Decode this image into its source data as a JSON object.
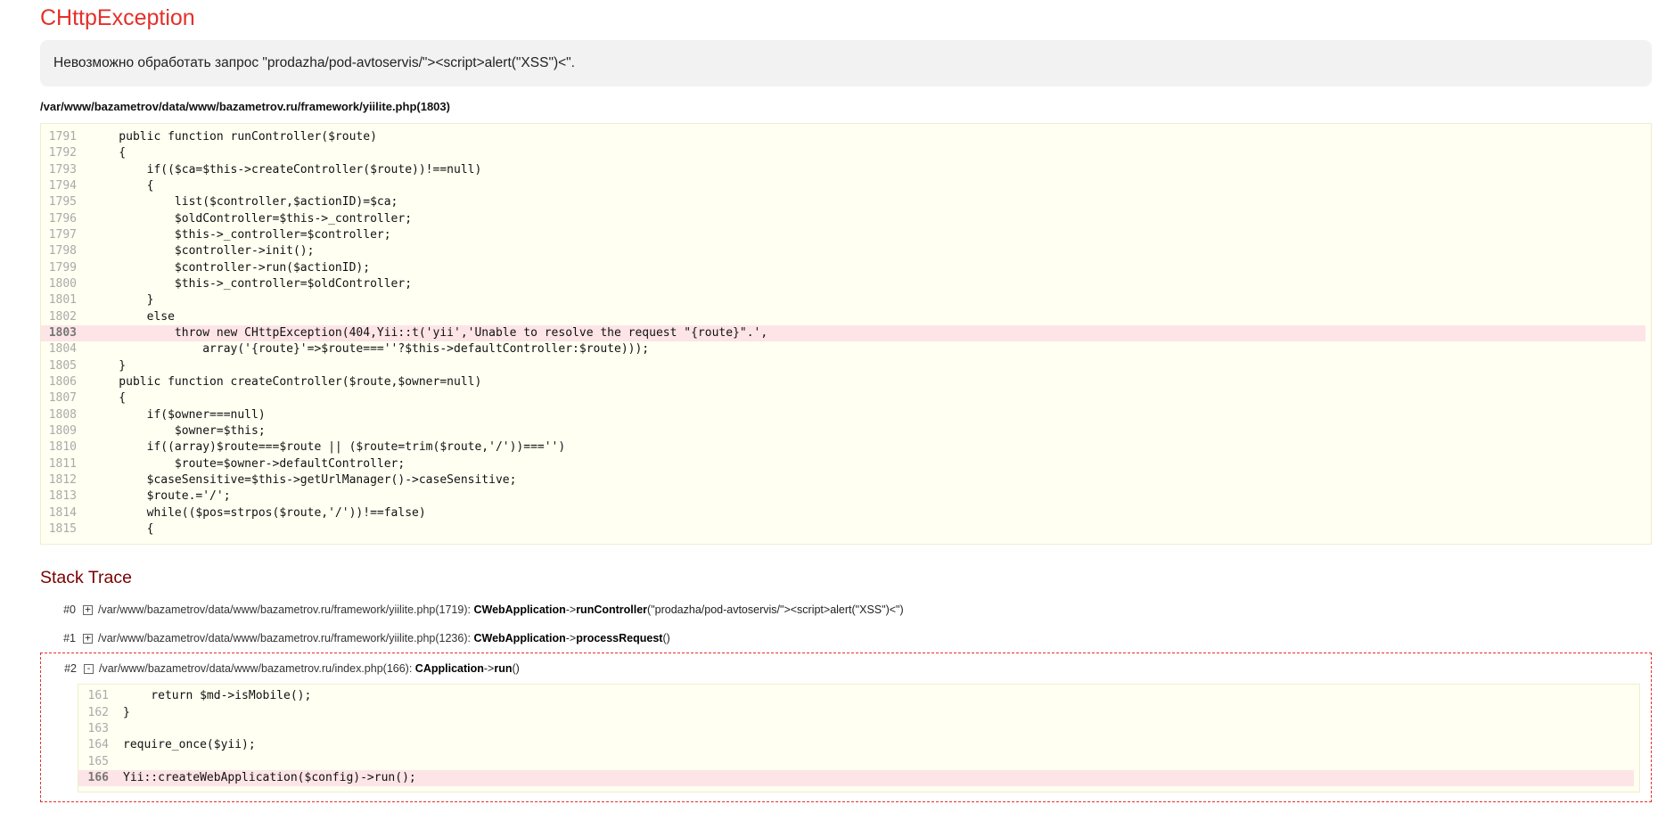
{
  "error": {
    "title": "CHttpException",
    "message": "Невозможно обработать запрос \"prodazha/pod-avtoservis/\"><script>alert(\"XSS\")<\".",
    "source_path": "/var/www/bazametrov/data/www/bazametrov.ru/framework/yiilite.php(1803)"
  },
  "source": {
    "lines": [
      {
        "num": "1791",
        "code": "    public function runController($route)",
        "error": false
      },
      {
        "num": "1792",
        "code": "    {",
        "error": false
      },
      {
        "num": "1793",
        "code": "        if(($ca=$this->createController($route))!==null)",
        "error": false
      },
      {
        "num": "1794",
        "code": "        {",
        "error": false
      },
      {
        "num": "1795",
        "code": "            list($controller,$actionID)=$ca;",
        "error": false
      },
      {
        "num": "1796",
        "code": "            $oldController=$this->_controller;",
        "error": false
      },
      {
        "num": "1797",
        "code": "            $this->_controller=$controller;",
        "error": false
      },
      {
        "num": "1798",
        "code": "            $controller->init();",
        "error": false
      },
      {
        "num": "1799",
        "code": "            $controller->run($actionID);",
        "error": false
      },
      {
        "num": "1800",
        "code": "            $this->_controller=$oldController;",
        "error": false
      },
      {
        "num": "1801",
        "code": "        }",
        "error": false
      },
      {
        "num": "1802",
        "code": "        else",
        "error": false
      },
      {
        "num": "1803",
        "code": "            throw new CHttpException(404,Yii::t('yii','Unable to resolve the request \"{route}\".',",
        "error": true
      },
      {
        "num": "1804",
        "code": "                array('{route}'=>$route===''?$this->defaultController:$route)));",
        "error": false
      },
      {
        "num": "1805",
        "code": "    }",
        "error": false
      },
      {
        "num": "1806",
        "code": "    public function createController($route,$owner=null)",
        "error": false
      },
      {
        "num": "1807",
        "code": "    {",
        "error": false
      },
      {
        "num": "1808",
        "code": "        if($owner===null)",
        "error": false
      },
      {
        "num": "1809",
        "code": "            $owner=$this;",
        "error": false
      },
      {
        "num": "1810",
        "code": "        if((array)$route===$route || ($route=trim($route,'/'))==='')",
        "error": false
      },
      {
        "num": "1811",
        "code": "            $route=$owner->defaultController;",
        "error": false
      },
      {
        "num": "1812",
        "code": "        $caseSensitive=$this->getUrlManager()->caseSensitive;",
        "error": false
      },
      {
        "num": "1813",
        "code": "        $route.='/';",
        "error": false
      },
      {
        "num": "1814",
        "code": "        while(($pos=strpos($route,'/'))!==false)",
        "error": false
      },
      {
        "num": "1815",
        "code": "        {",
        "error": false
      }
    ]
  },
  "stack": {
    "title": "Stack Trace",
    "items": [
      {
        "num": "#0",
        "toggle": "+",
        "file": "/var/www/bazametrov/data/www/bazametrov.ru/framework/yiilite.php(1719):",
        "class": "CWebApplication",
        "arrow": "->",
        "method": "runController",
        "args": "(\"prodazha/pod-avtoservis/\"><script>alert(\"XSS\")<\")"
      },
      {
        "num": "#1",
        "toggle": "+",
        "file": "/var/www/bazametrov/data/www/bazametrov.ru/framework/yiilite.php(1236):",
        "class": "CWebApplication",
        "arrow": "->",
        "method": "processRequest",
        "args": "()"
      },
      {
        "num": "#2",
        "toggle": "-",
        "file": "/var/www/bazametrov/data/www/bazametrov.ru/index.php(166):",
        "class": "CApplication",
        "arrow": "->",
        "method": "run",
        "args": "()",
        "code": [
          {
            "num": "161",
            "code": "    return $md->isMobile();",
            "error": false
          },
          {
            "num": "162",
            "code": "}",
            "error": false
          },
          {
            "num": "163",
            "code": "",
            "error": false
          },
          {
            "num": "164",
            "code": "require_once($yii);",
            "error": false
          },
          {
            "num": "165",
            "code": "",
            "error": false
          },
          {
            "num": "166",
            "code": "Yii::createWebApplication($config)->run();",
            "error": true
          }
        ]
      }
    ]
  }
}
